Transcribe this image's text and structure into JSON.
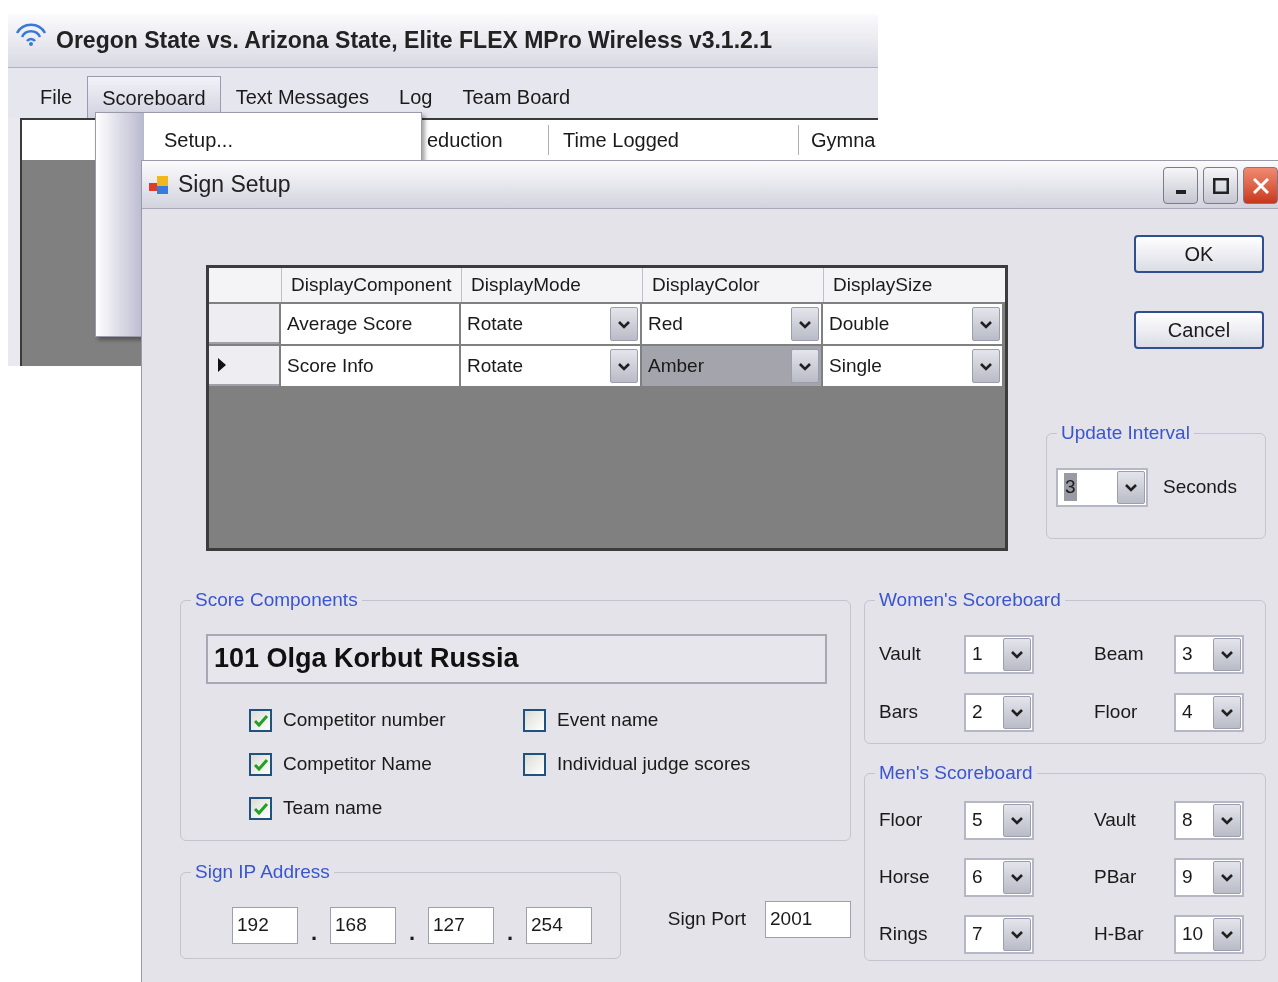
{
  "main_window": {
    "title": "Oregon State vs. Arizona State, Elite FLEX MPro Wireless v3.1.2.1",
    "menu": [
      {
        "label": "File",
        "selected": false
      },
      {
        "label": "Scoreboard",
        "selected": true
      },
      {
        "label": "Text Messages",
        "selected": false
      },
      {
        "label": "Log",
        "selected": false
      },
      {
        "label": "Team Board",
        "selected": false
      }
    ],
    "open_menu": {
      "items": [
        "Setup..."
      ]
    },
    "table": {
      "columns": [
        "eduction",
        "Time Logged",
        "Gymna"
      ]
    }
  },
  "dialog": {
    "title": "Sign Setup",
    "buttons": [
      "OK",
      "Cancel"
    ],
    "grid": {
      "columns": [
        "DisplayComponent",
        "DisplayMode",
        "DisplayColor",
        "DisplaySize"
      ],
      "rows": [
        {
          "current": false,
          "cells": [
            {
              "text": "Average Score",
              "dropdown": false,
              "selected": false
            },
            {
              "text": "Rotate",
              "dropdown": true,
              "selected": false
            },
            {
              "text": "Red",
              "dropdown": true,
              "selected": false
            },
            {
              "text": "Double",
              "dropdown": true,
              "selected": false
            }
          ]
        },
        {
          "current": true,
          "cells": [
            {
              "text": "Score Info",
              "dropdown": false,
              "selected": false
            },
            {
              "text": "Rotate",
              "dropdown": true,
              "selected": false
            },
            {
              "text": "Amber",
              "dropdown": true,
              "selected": true
            },
            {
              "text": "Single",
              "dropdown": true,
              "selected": false
            }
          ]
        }
      ]
    },
    "update_interval": {
      "title": "Update Interval",
      "value": "3",
      "unit": "Seconds"
    },
    "score_components": {
      "title": "Score Components",
      "preview": "101 Olga Korbut Russia",
      "options": [
        {
          "label": "Competitor number",
          "checked": true
        },
        {
          "label": "Competitor Name",
          "checked": true
        },
        {
          "label": "Team name",
          "checked": true
        },
        {
          "label": "Event name",
          "checked": false
        },
        {
          "label": "Individual judge scores",
          "checked": false
        }
      ]
    },
    "sign_ip": {
      "title": "Sign IP Address",
      "octets": [
        "192",
        "168",
        "127",
        "254"
      ],
      "separator": "."
    },
    "sign_port": {
      "label": "Sign Port",
      "value": "2001"
    },
    "womens_scoreboard": {
      "title": "Women's Scoreboard",
      "events": [
        {
          "label": "Vault",
          "value": "1"
        },
        {
          "label": "Beam",
          "value": "3"
        },
        {
          "label": "Bars",
          "value": "2"
        },
        {
          "label": "Floor",
          "value": "4"
        }
      ]
    },
    "mens_scoreboard": {
      "title": "Men's Scoreboard",
      "events": [
        {
          "label": "Floor",
          "value": "5"
        },
        {
          "label": "Vault",
          "value": "8"
        },
        {
          "label": "Horse",
          "value": "6"
        },
        {
          "label": "PBar",
          "value": "9"
        },
        {
          "label": "Rings",
          "value": "7"
        },
        {
          "label": "H-Bar",
          "value": "10"
        }
      ]
    }
  }
}
